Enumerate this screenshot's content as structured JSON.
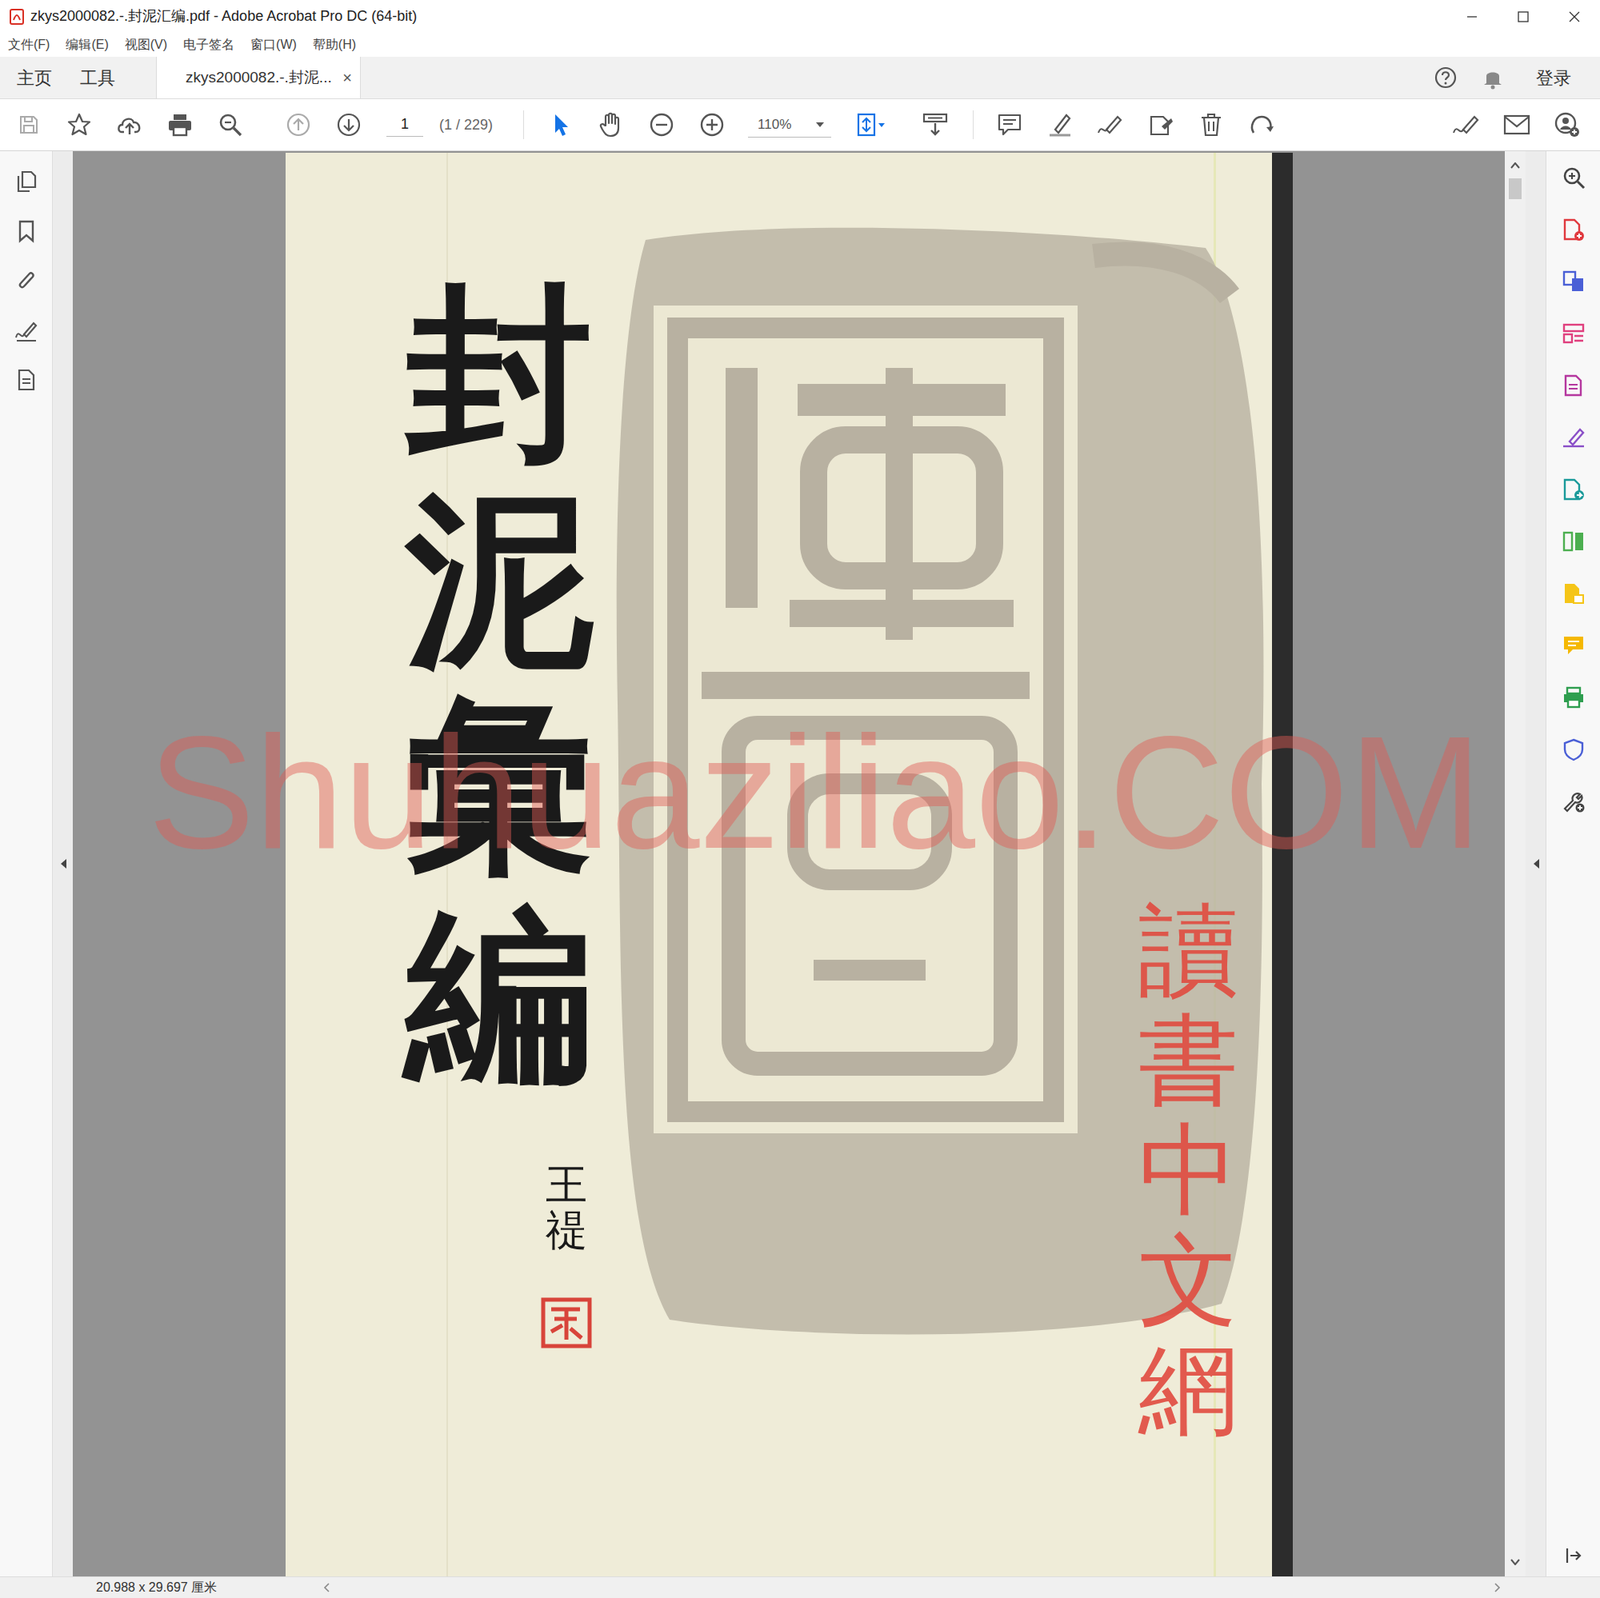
{
  "window": {
    "title": "zkys2000082.-.封泥汇编.pdf - Adobe Acrobat Pro DC (64-bit)"
  },
  "menu": [
    "文件(F)",
    "编辑(E)",
    "视图(V)",
    "电子签名",
    "窗口(W)",
    "帮助(H)"
  ],
  "nav": [
    {
      "label": "主页",
      "selected": false
    },
    {
      "label": "工具",
      "selected": false
    }
  ],
  "tabs": [
    {
      "label": "zkys2000082.-.封泥...",
      "close": "×",
      "selected": true
    }
  ],
  "account": {
    "login": "登录"
  },
  "toolbar": {
    "page_input": "1",
    "page_count": "(1 / 229)",
    "zoom": "110%",
    "select_active": true
  },
  "document": {
    "title": "封泥彙編",
    "author": "王禔",
    "stamp": "讀書中文網",
    "watermark": "Shuhuaziliao.COM"
  },
  "status_bar": {
    "page_size": "20.988 x 29.697 厘米"
  }
}
